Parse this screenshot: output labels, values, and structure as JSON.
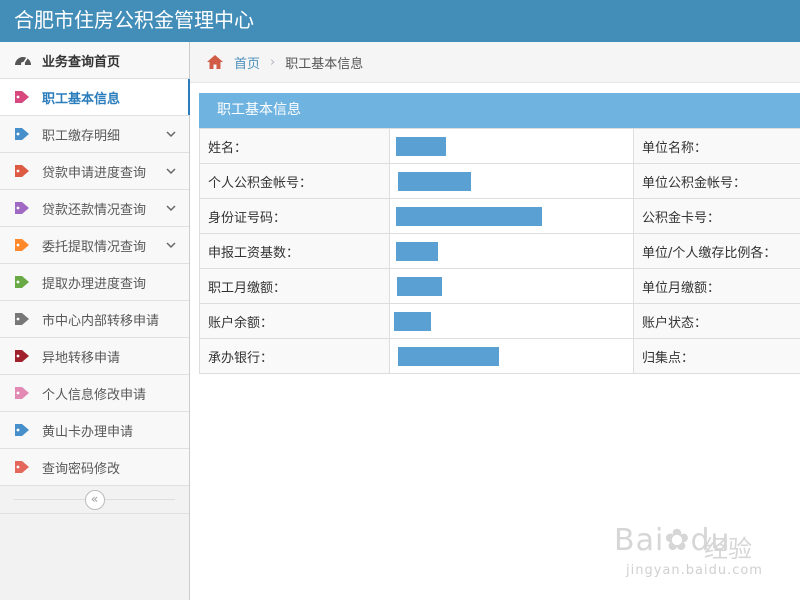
{
  "app": {
    "title": "合肥市住房公积金管理中心"
  },
  "sidebar": {
    "items": [
      {
        "label": "业务查询首页",
        "icon": "dashboard-icon",
        "color": "#555555"
      },
      {
        "label": "职工基本信息",
        "icon": "tag-icon",
        "color": "#d6487e"
      },
      {
        "label": "职工缴存明细",
        "icon": "tag-icon",
        "color": "#478fca"
      },
      {
        "label": "贷款申请进度查询",
        "icon": "tag-icon",
        "color": "#dd5a43"
      },
      {
        "label": "贷款还款情况查询",
        "icon": "tag-icon",
        "color": "#a069c3"
      },
      {
        "label": "委托提取情况查询",
        "icon": "tag-icon",
        "color": "#ff892a"
      },
      {
        "label": "提取办理进度查询",
        "icon": "tag-icon",
        "color": "#69aa46"
      },
      {
        "label": "市中心内部转移申请",
        "icon": "tag-icon",
        "color": "#777777"
      },
      {
        "label": "异地转移申请",
        "icon": "tag-icon",
        "color": "#a0202b"
      },
      {
        "label": "个人信息修改申请",
        "icon": "tag-icon",
        "color": "#e28ab4"
      },
      {
        "label": "黄山卡办理申请",
        "icon": "tag-icon",
        "color": "#478fca"
      },
      {
        "label": "查询密码修改",
        "icon": "tag-icon",
        "color": "#e4685b"
      }
    ],
    "collapse_label": "«"
  },
  "breadcrumb": {
    "home": "首页",
    "separator": "›",
    "current": "职工基本信息"
  },
  "panel": {
    "title": "职工基本信息",
    "rows": [
      {
        "left_label": "姓名：",
        "left_value": "",
        "right_label": "单位名称：",
        "right_value": ""
      },
      {
        "left_label": "个人公积金帐号：",
        "left_value": "",
        "right_label": "单位公积金帐号：",
        "right_value": ""
      },
      {
        "left_label": "身份证号码：",
        "left_value": "",
        "right_label": "公积金卡号：",
        "right_value": ""
      },
      {
        "left_label": "申报工资基数：",
        "left_value": "",
        "right_label": "单位/个人缴存比例各：",
        "right_value": ""
      },
      {
        "left_label": "职工月缴额：",
        "left_value": "",
        "right_label": "单位月缴额：",
        "right_value": ""
      },
      {
        "left_label": "账户余额：",
        "left_value": "",
        "right_label": "账户状态：",
        "right_value": ""
      },
      {
        "left_label": "承办银行：",
        "left_value": "",
        "right_label": "归集点：",
        "right_value": ""
      }
    ]
  },
  "watermark": {
    "main": "Bai",
    "paw": "du",
    "cn": "经验",
    "sub": "jingyan.baidu.com"
  },
  "colors": {
    "topbar": "#438eb9",
    "panel_header": "#6fb3e0",
    "link": "#4c8fbd",
    "redaction": "#5aa0d2"
  }
}
